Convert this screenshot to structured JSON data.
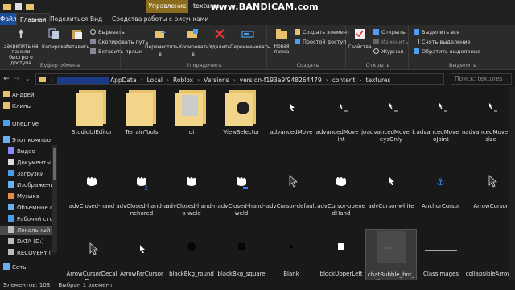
{
  "titlebar": {
    "manage_tab": "Управление",
    "window_title": "textures",
    "watermark": "www.BANDICAM.com"
  },
  "ribbon_tabs": [
    {
      "label": "Файл"
    },
    {
      "label": "Главная"
    },
    {
      "label": "Поделиться"
    },
    {
      "label": "Вид"
    },
    {
      "label": "Средства работы с рисунками"
    }
  ],
  "ribbon": {
    "clipboard": {
      "pin": "Закрепить на панели быстрого доступа",
      "copy": "Копировать",
      "paste": "Вставить",
      "cut": "Вырезать",
      "copy_path": "Скопировать путь",
      "paste_shortcut": "Вставить ярлык",
      "label": "Буфер обмена"
    },
    "organize": {
      "move_to": "Переместить в",
      "copy_to": "Копировать в",
      "delete": "Удалить",
      "rename": "Переименовать",
      "label": "Упорядочить"
    },
    "create": {
      "new_folder": "Новая папка",
      "new_item": "Создать элемент",
      "easy_access": "Простой доступ",
      "label": "Создать"
    },
    "open": {
      "properties": "Свойства",
      "open": "Открыть",
      "edit": "Изменить",
      "history": "Журнал",
      "label": "Открыть"
    },
    "select": {
      "select_all": "Выделить все",
      "select_none": "Снять выделение",
      "invert": "Обратить выделение",
      "label": "Выделить"
    }
  },
  "address": {
    "crumbs": [
      "AppData",
      "Local",
      "Roblox",
      "Versions",
      "version-f193a9f948264479",
      "content",
      "textures"
    ],
    "search_placeholder": "Поиск: textures"
  },
  "navpane": [
    {
      "label": "Андрей",
      "icon": "folder-icon"
    },
    {
      "label": "Клипы",
      "icon": "folder-icon"
    },
    {
      "label": "OneDrive",
      "icon": "cloud-icon"
    },
    {
      "label": "Этот компьютер",
      "icon": "computer-icon"
    },
    {
      "label": "Видео",
      "icon": "video-icon"
    },
    {
      "label": "Документы",
      "icon": "document-icon"
    },
    {
      "label": "Загрузки",
      "icon": "download-icon"
    },
    {
      "label": "Изображения",
      "icon": "picture-icon"
    },
    {
      "label": "Музыка",
      "icon": "music-icon"
    },
    {
      "label": "Объемные объекты",
      "icon": "cube-icon"
    },
    {
      "label": "Рабочий стол",
      "icon": "desktop-icon"
    },
    {
      "label": "Локальный диск (C:)",
      "icon": "drive-icon"
    },
    {
      "label": "DATA (D:)",
      "icon": "drive-icon"
    },
    {
      "label": "RECOVERY (E:)",
      "icon": "drive-icon"
    },
    {
      "label": "Сеть",
      "icon": "network-icon"
    }
  ],
  "files": [
    {
      "name": "StudioUIEditor",
      "kind": "folder"
    },
    {
      "name": "TerrainTools",
      "kind": "folder"
    },
    {
      "name": "ui",
      "kind": "folder-doc"
    },
    {
      "name": "ViewSelector",
      "kind": "folder-dark"
    },
    {
      "name": "advancedMove",
      "kind": "cursor"
    },
    {
      "name": "advancedMove_joint",
      "kind": "cursor-small"
    },
    {
      "name": "advancedMove_keysOnly",
      "kind": "cursor-small"
    },
    {
      "name": "advancedMove_noJoint",
      "kind": "cursor-small"
    },
    {
      "name": "advancedMove_resize",
      "kind": "cursor-small"
    },
    {
      "name": "advClosed-hand",
      "kind": "hand"
    },
    {
      "name": "advClosed-hand-anchored",
      "kind": "hand-anchor"
    },
    {
      "name": "advClosed-hand-no-weld",
      "kind": "hand"
    },
    {
      "name": "advClosed-hand-weld",
      "kind": "hand-weld"
    },
    {
      "name": "advCursor-default",
      "kind": "cursor-outline"
    },
    {
      "name": "advCursor-openedHand",
      "kind": "hand"
    },
    {
      "name": "advCursor-white",
      "kind": "cursor"
    },
    {
      "name": "AnchorCursor",
      "kind": "anchor"
    },
    {
      "name": "ArrowCursor",
      "kind": "cursor-outline"
    },
    {
      "name": "ArrowCursorDecalDrag",
      "kind": "cursor-outline"
    },
    {
      "name": "ArrowFarCursor",
      "kind": "cursor"
    },
    {
      "name": "blackBkg_round",
      "kind": "dot"
    },
    {
      "name": "blackBkg_square",
      "kind": "square-dark"
    },
    {
      "name": "Blank",
      "kind": "dot-small"
    },
    {
      "name": "blockUpperLeft",
      "kind": "square-white"
    },
    {
      "name": "chatBubble_bot_notifyGray_dotDotDot",
      "kind": "dots",
      "selected": true
    },
    {
      "name": "ClassImages",
      "kind": "strip"
    },
    {
      "name": "collapsibleArrowDown",
      "kind": "empty"
    }
  ],
  "status": {
    "count": "Элементов: 103",
    "selected": "Выбран 1 элемент"
  },
  "colors": {
    "accent": "#1c4f9a",
    "manage": "#8a6c1c",
    "folder": "#e8c26a",
    "anchor": "#3b82f6"
  }
}
